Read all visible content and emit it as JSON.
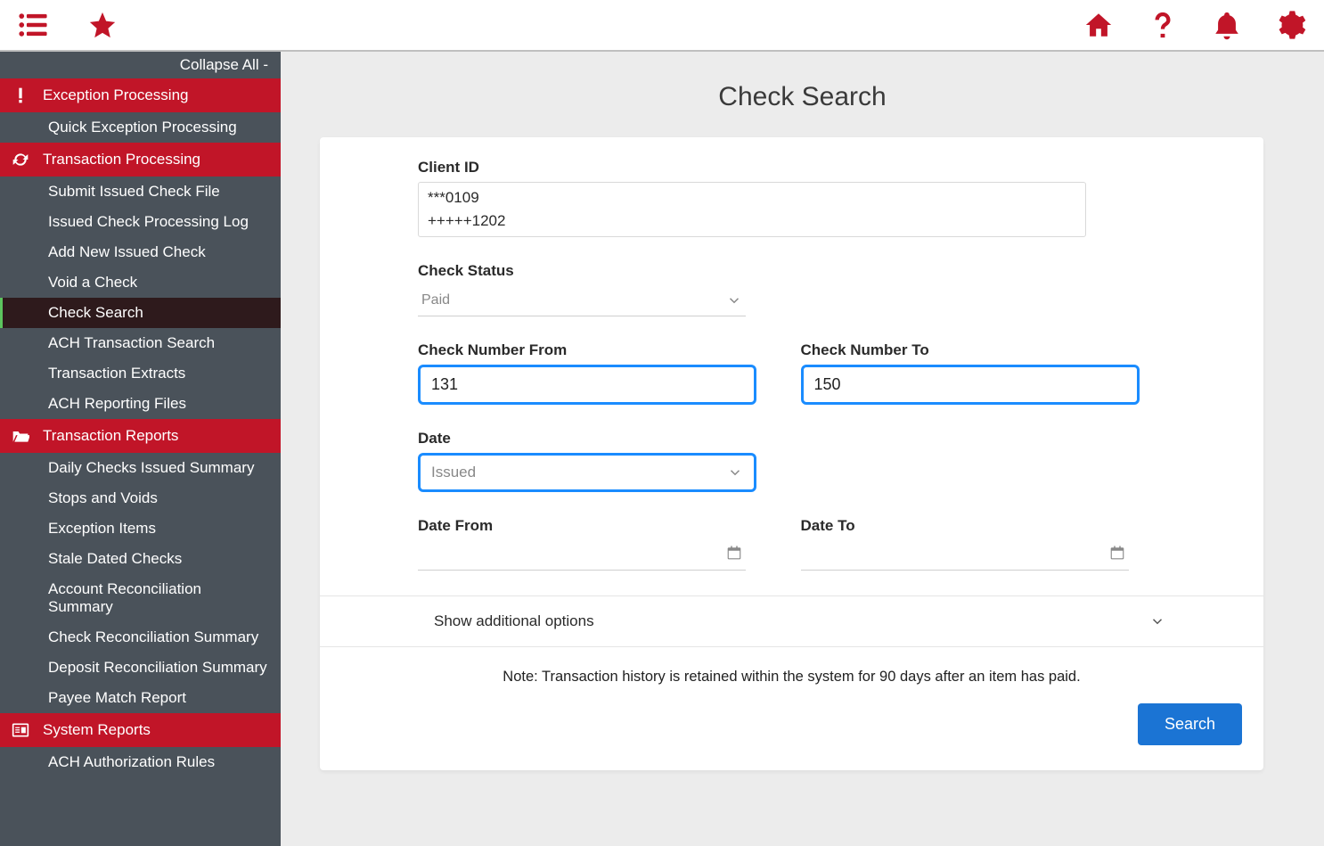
{
  "topbar": {
    "menu_icon": "menu",
    "favorite_icon": "star",
    "home_icon": "home",
    "help_icon": "help",
    "alerts_icon": "bell",
    "settings_icon": "gear"
  },
  "sidebar": {
    "collapse_label": "Collapse All -",
    "sections": [
      {
        "title": "Exception Processing",
        "icon": "exclamation",
        "items": [
          {
            "label": "Quick Exception Processing",
            "active": false
          }
        ]
      },
      {
        "title": "Transaction Processing",
        "icon": "refresh",
        "items": [
          {
            "label": "Submit Issued Check File",
            "active": false
          },
          {
            "label": "Issued Check Processing Log",
            "active": false
          },
          {
            "label": "Add New Issued Check",
            "active": false
          },
          {
            "label": "Void a Check",
            "active": false
          },
          {
            "label": "Check Search",
            "active": true
          },
          {
            "label": "ACH Transaction Search",
            "active": false
          },
          {
            "label": "Transaction Extracts",
            "active": false
          },
          {
            "label": "ACH Reporting Files",
            "active": false
          }
        ]
      },
      {
        "title": "Transaction Reports",
        "icon": "folder-open",
        "items": [
          {
            "label": "Daily Checks Issued Summary",
            "active": false
          },
          {
            "label": "Stops and Voids",
            "active": false
          },
          {
            "label": "Exception Items",
            "active": false
          },
          {
            "label": "Stale Dated Checks",
            "active": false
          },
          {
            "label": "Account Reconciliation Summary",
            "active": false
          },
          {
            "label": "Check Reconciliation Summary",
            "active": false
          },
          {
            "label": "Deposit Reconciliation Summary",
            "active": false
          },
          {
            "label": "Payee Match Report",
            "active": false
          }
        ]
      },
      {
        "title": "System Reports",
        "icon": "report",
        "items": [
          {
            "label": "ACH Authorization Rules",
            "active": false
          }
        ]
      }
    ]
  },
  "page": {
    "title": "Check Search",
    "client_id_label": "Client ID",
    "client_ids": [
      "***0109",
      "+++++1202"
    ],
    "check_status_label": "Check Status",
    "check_status_value": "Paid",
    "check_number_from_label": "Check Number From",
    "check_number_from_value": "131",
    "check_number_to_label": "Check Number To",
    "check_number_to_value": "150",
    "date_label": "Date",
    "date_type_value": "Issued",
    "date_from_label": "Date From",
    "date_from_value": "",
    "date_to_label": "Date To",
    "date_to_value": "",
    "show_options_label": "Show additional options",
    "note_text": "Note: Transaction history is retained within the system for 90 days after an item has paid.",
    "search_button_label": "Search"
  }
}
